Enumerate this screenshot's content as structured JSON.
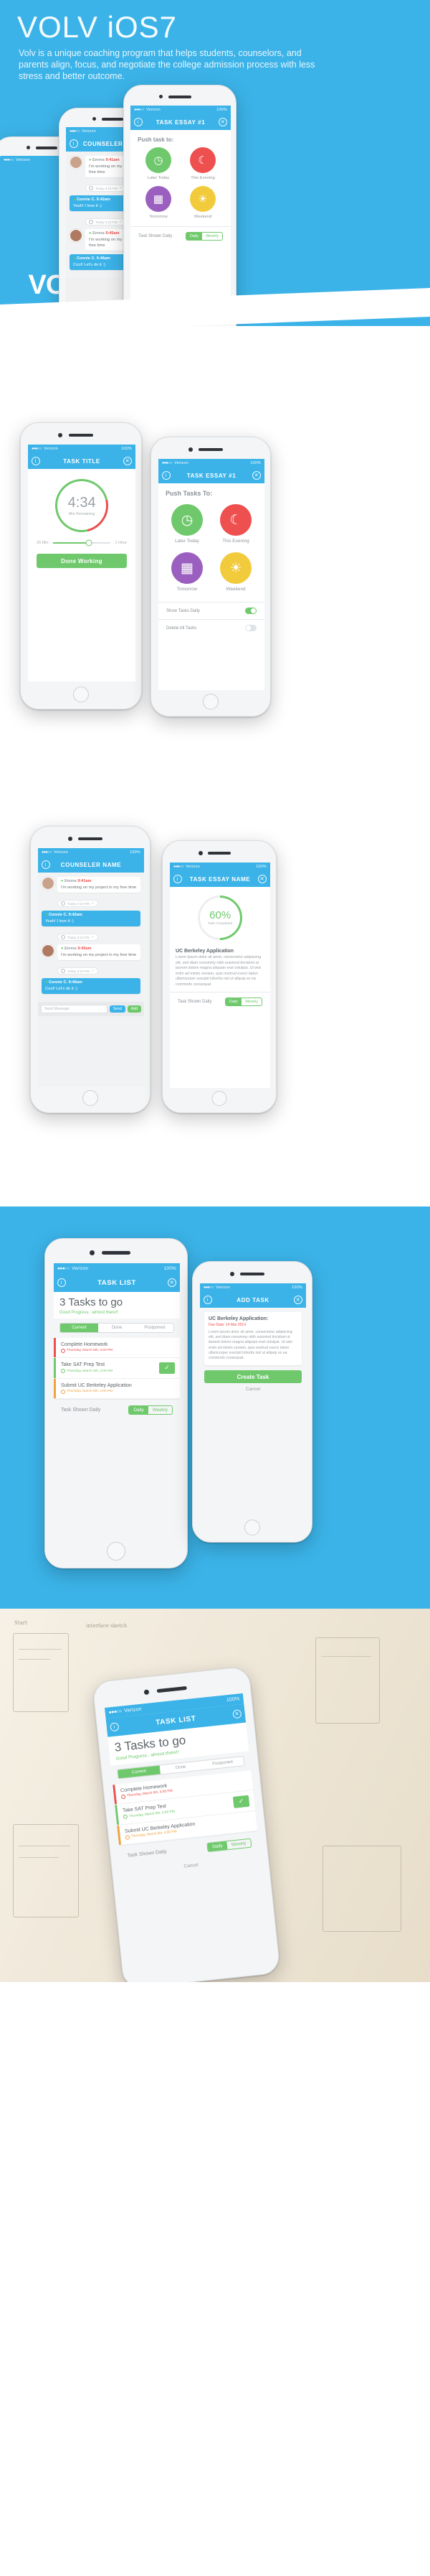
{
  "hero": {
    "title": "VOLV iOS7",
    "subtitle": "Volv is a unique coaching program that helps students, counselors, and parents align, focus, and negotiate the college admission process with less stress and better outcome.",
    "brand_color": "#3bb3e8",
    "accent_green": "#6fc96c",
    "accent_red": "#ee4f4f",
    "accent_orange": "#f0a33c",
    "accent_purple": "#9b5fc0",
    "accent_yellow": "#f2cb3c"
  },
  "status": {
    "dots": "●●●○○",
    "carrier": "Verizon",
    "battery": "100%"
  },
  "screens": {
    "push": {
      "nav_title": "TASK ESSAY #1",
      "heading": "Push task to:",
      "options": [
        {
          "label": "Later Today",
          "icon": "clock-icon",
          "glyph": "◷",
          "color": "#6fc96c"
        },
        {
          "label": "This Evening",
          "icon": "moon-icon",
          "glyph": "☾",
          "color": "#ee4f4f"
        },
        {
          "label": "Tomorrow",
          "icon": "calendar-icon",
          "glyph": "▦",
          "color": "#9b5fc0"
        },
        {
          "label": "Weekend",
          "icon": "sun-icon",
          "glyph": "☀",
          "color": "#f2cb3c"
        }
      ],
      "rows": [
        {
          "label": "Task Shown Daily",
          "control": "segmented",
          "options": [
            "Daily",
            "Weekly"
          ],
          "selected": "Daily"
        }
      ]
    },
    "push_large": {
      "nav_title": "TASK ESSAY #1",
      "heading": "Push Tasks To:",
      "options": [
        {
          "label": "Later Today",
          "icon": "clock-icon",
          "glyph": "◷",
          "color": "#6fc96c"
        },
        {
          "label": "This Evening",
          "icon": "moon-icon",
          "glyph": "☾",
          "color": "#ee4f4f"
        },
        {
          "label": "Tomorrow",
          "icon": "calendar-icon",
          "glyph": "▦",
          "color": "#9b5fc0"
        },
        {
          "label": "Weekend",
          "icon": "sun-icon",
          "glyph": "☀",
          "color": "#f2cb3c"
        }
      ],
      "toggles": [
        {
          "label": "Show Tasks Daily",
          "state": "on"
        },
        {
          "label": "Delete All Tasks",
          "state": "off"
        }
      ]
    },
    "timer": {
      "nav_title": "TASK TITLE",
      "value": "4:34",
      "unit_label": "Min Remaining",
      "slider_min": "20 Min",
      "slider_max": "1 Hour",
      "button": "Done Working"
    },
    "counselor": {
      "nav_title": "COUNSELER NAME",
      "messages": [
        {
          "name": "Emma",
          "time": "9:41am",
          "text": "I'm working on my project in my free time",
          "stamp": "Today 3:10 PM",
          "side": "them"
        },
        {
          "name": "Connie C.",
          "time": "9:42am",
          "text": "Yeah! I love it :)",
          "stamp": "Today 3:10 PM",
          "side": "me"
        },
        {
          "name": "Emma",
          "time": "9:45am",
          "text": "I'm working on my project in my free time",
          "stamp": "Today 3:10 PM",
          "side": "them"
        },
        {
          "name": "Connie C.",
          "time": "9:46am",
          "text": "Cool! Let's do it :)",
          "stamp": "Today 3:10 PM",
          "side": "me"
        }
      ],
      "input_placeholder": "Send Message",
      "send_label": "Send",
      "attach_label": "Add"
    },
    "essay": {
      "nav_title": "TASK ESSAY NAME",
      "percent": "60%",
      "percent_label": "Task Completed",
      "title": "UC Berkeley Application",
      "body": "Lorem ipsum dolor sit amet, consectetur adipiscing elit, sed diam nonummy nibh euismod tincidunt ut laoreet dolore magna aliquam erat volutpat. Ut wisi enim ad minim veniam, quis nostrud exerci tation ullamcorper suscipit lobortis nisl ut aliquip ex ea commodo consequat.",
      "footer_label": "Task Shown Daily",
      "footer_options": [
        "Daily",
        "Weekly"
      ],
      "footer_selected": "Daily"
    },
    "task_list": {
      "nav_title": "TASK LIST",
      "headline": "3 Tasks to go",
      "subhead": "Good Progress.. almost there!!",
      "tabs": [
        "Current",
        "Done",
        "Postponed"
      ],
      "active_tab": "Current",
      "tasks": [
        {
          "name": "Complete Homework",
          "due": "Thursday, March 6th, 4:00 PM",
          "status": "overdue",
          "checked": false
        },
        {
          "name": "Take SAT Prep Test",
          "due": "Thursday, March 6th, 4:00 PM",
          "status": "ok",
          "checked": true
        },
        {
          "name": "Submit UC Berkeley Application",
          "due": "Thursday, March 6th, 4:00 PM",
          "status": "soon",
          "checked": false
        }
      ],
      "footer_label": "Task Shown Daily",
      "footer_options": [
        "Daily",
        "Weekly"
      ],
      "footer_selected": "Daily"
    },
    "add_task": {
      "nav_title": "ADD TASK",
      "card_title": "UC Berkeley Application:",
      "card_date": "Due Date: 14 Mar 2014",
      "card_body": "Lorem ipsum dolor sit amet, consectetur adipiscing elit, sed diam nonummy nibh euismod tincidunt ut laoreet dolore magna aliquam erat volutpat. Ut wisi enim ad minim veniam, quis nostrud exerci tation ullamcorper suscipit lobortis nisl ut aliquip ex ea commodo consequat.",
      "submit": "Create Task",
      "cancel": "Cancel"
    }
  },
  "icons": {
    "info": "i",
    "close": "✕",
    "check": "✓",
    "clock": "◷"
  }
}
